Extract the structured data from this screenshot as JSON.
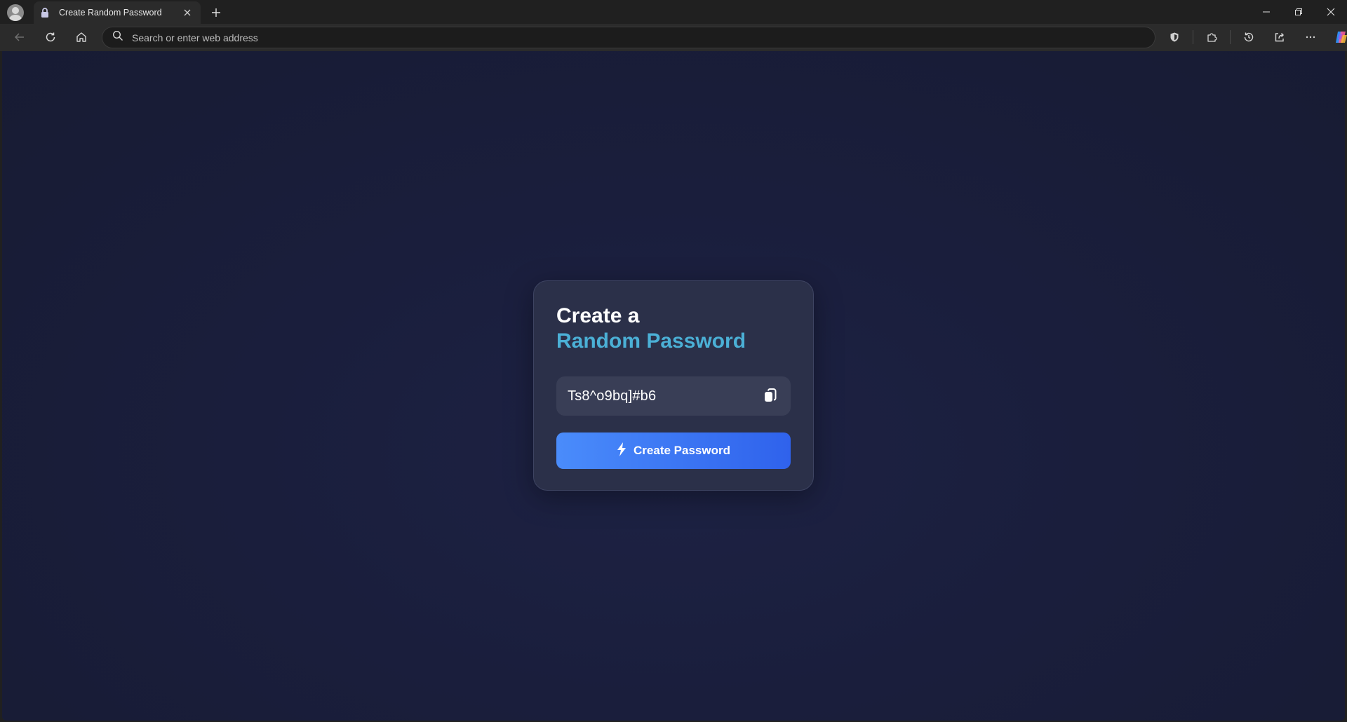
{
  "browser": {
    "tab": {
      "title": "Create Random Password"
    },
    "address_bar": {
      "placeholder": "Search or enter web address",
      "value": ""
    }
  },
  "page": {
    "heading_line1": "Create a",
    "heading_line2": "Random Password",
    "password": "Ts8^o9bq]#b6",
    "create_button_label": "Create Password"
  },
  "colors": {
    "accent_heading": "#4bb0d6",
    "button_gradient_start": "#4a8cfb",
    "button_gradient_end": "#2f62ec",
    "page_background": "#1a1e3c",
    "card_background": "#2b3049"
  },
  "icons": {
    "tab": "lock-icon",
    "password_copy": "copy-icon",
    "create_button": "lightning-bolt-icon"
  }
}
